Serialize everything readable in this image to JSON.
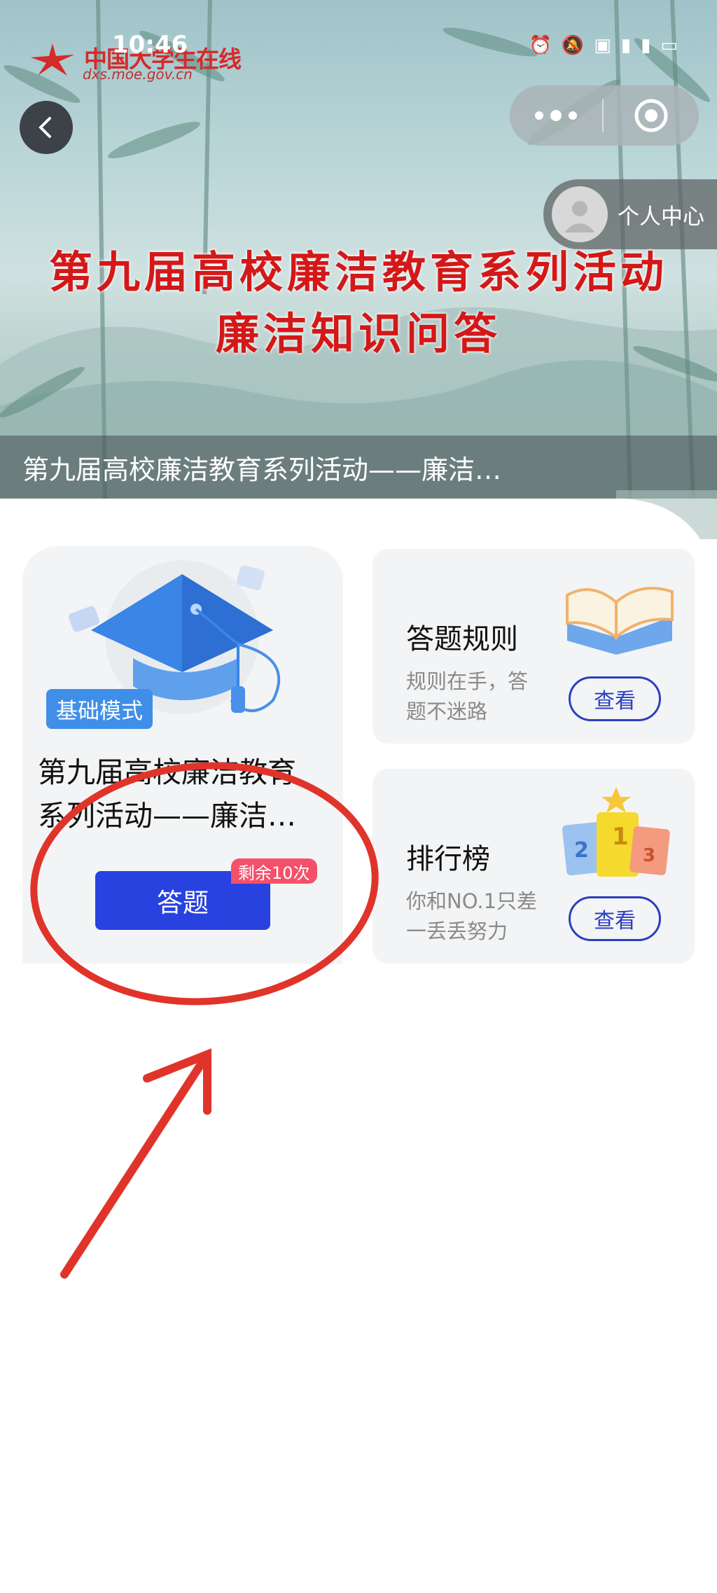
{
  "status_bar": {
    "time": "10:46",
    "icons": [
      "alarm-icon",
      "mute-icon",
      "hd-icon",
      "signal-5g-icon",
      "signal-icon",
      "battery-icon"
    ]
  },
  "logo": {
    "name": "中国大学生在线",
    "url": "dxs.moe.gov.cn"
  },
  "nav": {
    "personal_center": "个人中心"
  },
  "banner": {
    "headline_line1": "第九届高校廉洁教育系列活动",
    "headline_line2": "廉洁知识问答",
    "caption": "第九届高校廉洁教育系列活动——廉洁…"
  },
  "quiz_card": {
    "mode_badge": "基础模式",
    "title_line1": "第九届高校廉洁教育",
    "title_line2": "系列活动——廉洁…",
    "answer_button": "答题",
    "remaining": "剩余10次"
  },
  "rules_card": {
    "title": "答题规则",
    "desc_line1": "规则在手，答",
    "desc_line2": "题不迷路",
    "button": "查看"
  },
  "ranking_card": {
    "title": "排行榜",
    "desc_line1": "你和NO.1只差",
    "desc_line2": "一丢丢努力",
    "button": "查看",
    "ranks": [
      "2",
      "1",
      "3"
    ]
  },
  "colors": {
    "primary": "#2842e0",
    "headline_red": "#d41818",
    "badge_pink": "#f4506a",
    "annotation_red": "#e0342a"
  }
}
